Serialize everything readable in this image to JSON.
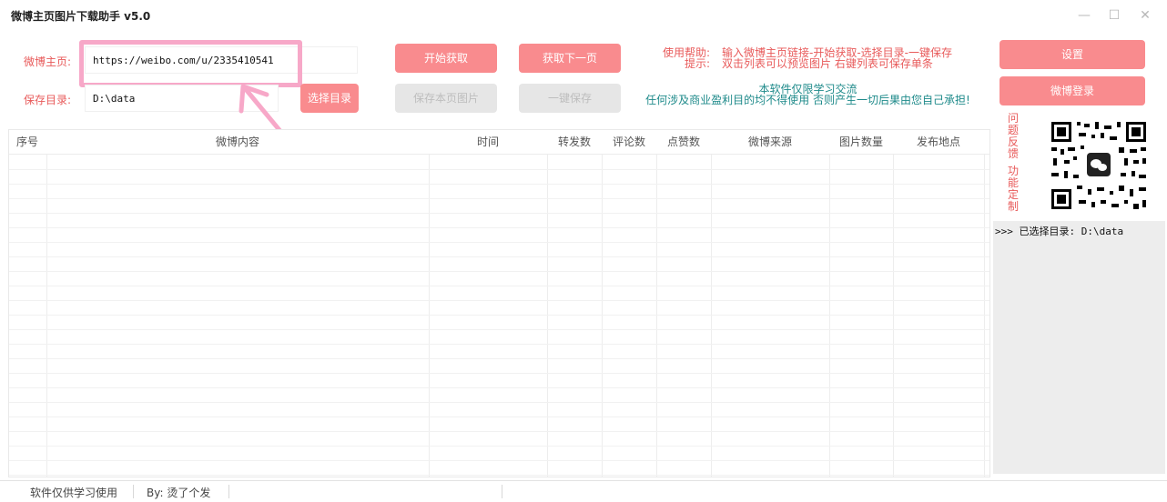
{
  "window": {
    "title": "微博主页图片下载助手 v5.0",
    "minimize": "—",
    "maximize": "☐",
    "close": "✕"
  },
  "form": {
    "homepage_label": "微博主页:",
    "homepage_value": "https://weibo.com/u/2335410541",
    "save_label": "保存目录:",
    "save_value": "D:\\data",
    "choose_dir": "选择目录"
  },
  "buttons": {
    "start": "开始获取",
    "next_page": "获取下一页",
    "save_page": "保存本页图片",
    "save_all": "一键保存",
    "settings": "设置",
    "login": "微博登录"
  },
  "help": {
    "label1": "使用帮助:",
    "text1": "输入微博主页链接-开始获取-选择目录-一键保存",
    "label2": "提示:",
    "text2": "双击列表可以预览图片 右键列表可保存单条"
  },
  "notice": {
    "line1": "本软件仅限学习交流",
    "line2": "任何涉及商业盈利目的均不得使用 否则产生一切后果由您自己承担!"
  },
  "table": {
    "columns": [
      "序号",
      "微博内容",
      "时间",
      "转发数",
      "评论数",
      "点赞数",
      "微博来源",
      "图片数量",
      "发布地点"
    ]
  },
  "side": {
    "feedback": "问题反馈",
    "custom": "功能定制"
  },
  "log": {
    "line": ">>> 已选择目录: D:\\data"
  },
  "status": {
    "left": "软件仅供学习使用",
    "author": "By: 烫了个发"
  },
  "colors": {
    "accent": "#f98b8e",
    "label": "#e85a5a",
    "notice": "#1e8a8a",
    "highlight": "#f7a8c8"
  }
}
